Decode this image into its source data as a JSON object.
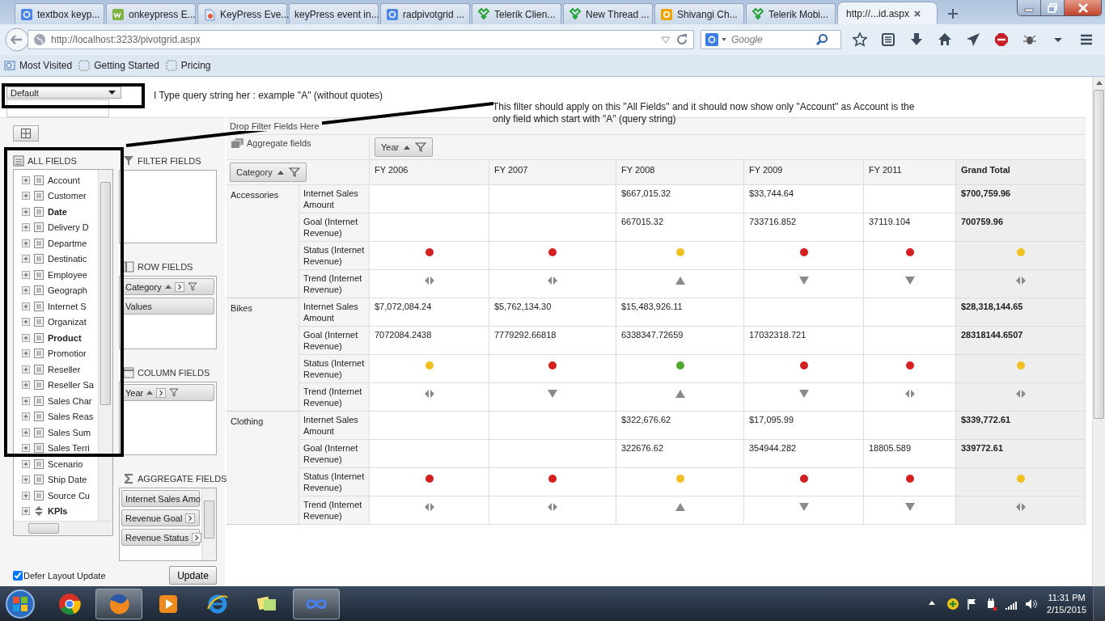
{
  "browser": {
    "tabs": [
      {
        "title": "textbox keyp...",
        "selected": false
      },
      {
        "title": "onkeypress E...",
        "selected": false
      },
      {
        "title": "KeyPress Eve...",
        "selected": false
      },
      {
        "title": "keyPress event in...",
        "selected": false
      },
      {
        "title": "radpivotgrid ...",
        "selected": false
      },
      {
        "title": "Telerik Clien...",
        "selected": false
      },
      {
        "title": "New Thread ...",
        "selected": false
      },
      {
        "title": "Shivangi Ch...",
        "selected": false
      },
      {
        "title": "Telerik Mobi...",
        "selected": false
      },
      {
        "title": "http://...id.aspx",
        "selected": true
      }
    ],
    "url": "http://localhost:3233/pivotgrid.aspx",
    "search_placeholder": "Google",
    "bookmarks": [
      "Most Visited",
      "Getting Started",
      "Pricing"
    ]
  },
  "page": {
    "view_select": "Default"
  },
  "annotations": [
    "I Type query string her : example \"A\" (without quotes)",
    "This filter should apply on this \"All Fields\" and it should now show only \"Account\" as Account is the only field which start with \"A\" (query string)"
  ],
  "field_list": {
    "all_fields": {
      "title": "ALL FIELDS",
      "items": [
        {
          "label": "Account",
          "bold": false,
          "kind": "dimension"
        },
        {
          "label": "Customer",
          "bold": false,
          "kind": "dimension"
        },
        {
          "label": "Date",
          "bold": true,
          "kind": "dimension"
        },
        {
          "label": "Delivery D",
          "bold": false,
          "kind": "dimension"
        },
        {
          "label": "Departme",
          "bold": false,
          "kind": "dimension"
        },
        {
          "label": "Destinatic",
          "bold": false,
          "kind": "dimension"
        },
        {
          "label": "Employee",
          "bold": false,
          "kind": "dimension"
        },
        {
          "label": "Geograph",
          "bold": false,
          "kind": "dimension"
        },
        {
          "label": "Internet S",
          "bold": false,
          "kind": "dimension"
        },
        {
          "label": "Organizat",
          "bold": false,
          "kind": "dimension"
        },
        {
          "label": "Product",
          "bold": true,
          "kind": "dimension"
        },
        {
          "label": "Promotior",
          "bold": false,
          "kind": "dimension"
        },
        {
          "label": "Reseller",
          "bold": false,
          "kind": "dimension"
        },
        {
          "label": "Reseller Sa",
          "bold": false,
          "kind": "dimension"
        },
        {
          "label": "Sales Char",
          "bold": false,
          "kind": "dimension"
        },
        {
          "label": "Sales Reas",
          "bold": false,
          "kind": "dimension"
        },
        {
          "label": "Sales Sum",
          "bold": false,
          "kind": "dimension"
        },
        {
          "label": "Sales Terri",
          "bold": false,
          "kind": "dimension"
        },
        {
          "label": "Scenario",
          "bold": false,
          "kind": "dimension"
        },
        {
          "label": "Ship Date",
          "bold": false,
          "kind": "dimension"
        },
        {
          "label": "Source Cu",
          "bold": false,
          "kind": "dimension"
        },
        {
          "label": "KPIs",
          "bold": true,
          "kind": "kpi"
        }
      ]
    },
    "sections": [
      {
        "kind": "filter",
        "title": "FILTER FIELDS"
      },
      {
        "kind": "row",
        "title": "ROW FIELDS",
        "chips": [
          {
            "label": "Category",
            "kind": "dimension"
          },
          {
            "label": "Values",
            "kind": "values"
          }
        ]
      },
      {
        "kind": "column",
        "title": "COLUMN FIELDS",
        "chips": [
          {
            "label": "Year",
            "kind": "dimension"
          }
        ]
      },
      {
        "kind": "aggregate",
        "title": "AGGREGATE FIELDS",
        "chips": [
          {
            "label": "Internet Sales Amo",
            "kind": "measure"
          },
          {
            "label": "Revenue Goal",
            "kind": "measure"
          },
          {
            "label": "Revenue Status",
            "kind": "measure"
          }
        ]
      }
    ],
    "defer_update": {
      "label": "Defer Layout Update",
      "checked": true
    },
    "update_button": "Update"
  },
  "pivot": {
    "filter_zone": "Drop Filter Fields Here",
    "aggregate_zone": "Aggregate fields",
    "column_chip": "Year",
    "row_chip": "Category",
    "columns": [
      {
        "label": "FY 2006",
        "kind": "year"
      },
      {
        "label": "FY 2007",
        "kind": "year"
      },
      {
        "label": "FY 2008",
        "kind": "year"
      },
      {
        "label": "FY 2009",
        "kind": "year"
      },
      {
        "label": "FY 2011",
        "kind": "year"
      },
      {
        "label": "Grand Total",
        "kind": "total"
      }
    ],
    "rows": [
      {
        "category": "Accessories",
        "measures": [
          {
            "label": "Internet Sales Amount",
            "cells": [
              {
                "kind": "blank"
              },
              {
                "kind": "blank"
              },
              {
                "kind": "text",
                "text": "$667,015.32"
              },
              {
                "kind": "text",
                "text": "$33,744.64"
              },
              {
                "kind": "blank"
              },
              {
                "kind": "text",
                "text": "$700,759.96"
              }
            ]
          },
          {
            "label": "Goal (Internet Revenue)",
            "cells": [
              {
                "kind": "blank"
              },
              {
                "kind": "blank"
              },
              {
                "kind": "text",
                "text": "667015.32"
              },
              {
                "kind": "text",
                "text": "733716.852"
              },
              {
                "kind": "text",
                "text": "37119.104"
              },
              {
                "kind": "text",
                "text": "700759.96"
              }
            ]
          },
          {
            "label": "Status (Internet Revenue)",
            "cells": [
              {
                "kind": "status",
                "color": "#d42020"
              },
              {
                "kind": "status",
                "color": "#d42020"
              },
              {
                "kind": "status",
                "color": "#f0c020"
              },
              {
                "kind": "status",
                "color": "#d42020"
              },
              {
                "kind": "status",
                "color": "#d42020"
              },
              {
                "kind": "status",
                "color": "#f0c020"
              }
            ]
          },
          {
            "label": "Trend (Internet Revenue)",
            "cells": [
              {
                "kind": "flat"
              },
              {
                "kind": "flat"
              },
              {
                "kind": "up"
              },
              {
                "kind": "down"
              },
              {
                "kind": "down"
              },
              {
                "kind": "flat"
              }
            ]
          }
        ]
      },
      {
        "category": "Bikes",
        "measures": [
          {
            "label": "Internet Sales Amount",
            "cells": [
              {
                "kind": "text",
                "text": "$7,072,084.24"
              },
              {
                "kind": "text",
                "text": "$5,762,134.30"
              },
              {
                "kind": "text",
                "text": "$15,483,926.11"
              },
              {
                "kind": "blank"
              },
              {
                "kind": "blank"
              },
              {
                "kind": "text",
                "text": "$28,318,144.65"
              }
            ]
          },
          {
            "label": "Goal (Internet Revenue)",
            "cells": [
              {
                "kind": "text",
                "text": "7072084.2438"
              },
              {
                "kind": "text",
                "text": "7779292.66818"
              },
              {
                "kind": "text",
                "text": "6338347.72659"
              },
              {
                "kind": "text",
                "text": "17032318.721"
              },
              {
                "kind": "blank"
              },
              {
                "kind": "text",
                "text": "28318144.6507"
              }
            ]
          },
          {
            "label": "Status (Internet Revenue)",
            "cells": [
              {
                "kind": "status",
                "color": "#f0c020"
              },
              {
                "kind": "status",
                "color": "#d42020"
              },
              {
                "kind": "status",
                "color": "#50a830"
              },
              {
                "kind": "status",
                "color": "#d42020"
              },
              {
                "kind": "status",
                "color": "#d42020"
              },
              {
                "kind": "status",
                "color": "#f0c020"
              }
            ]
          },
          {
            "label": "Trend (Internet Revenue)",
            "cells": [
              {
                "kind": "flat"
              },
              {
                "kind": "down"
              },
              {
                "kind": "up"
              },
              {
                "kind": "down"
              },
              {
                "kind": "flat"
              },
              {
                "kind": "flat"
              }
            ]
          }
        ]
      },
      {
        "category": "Clothing",
        "measures": [
          {
            "label": "Internet Sales Amount",
            "cells": [
              {
                "kind": "blank"
              },
              {
                "kind": "blank"
              },
              {
                "kind": "text",
                "text": "$322,676.62"
              },
              {
                "kind": "text",
                "text": "$17,095.99"
              },
              {
                "kind": "blank"
              },
              {
                "kind": "text",
                "text": "$339,772.61"
              }
            ]
          },
          {
            "label": "Goal (Internet Revenue)",
            "cells": [
              {
                "kind": "blank"
              },
              {
                "kind": "blank"
              },
              {
                "kind": "text",
                "text": "322676.62"
              },
              {
                "kind": "text",
                "text": "354944.282"
              },
              {
                "kind": "text",
                "text": "18805.589"
              },
              {
                "kind": "text",
                "text": "339772.61"
              }
            ]
          },
          {
            "label": "Status (Internet Revenue)",
            "cells": [
              {
                "kind": "status",
                "color": "#d42020"
              },
              {
                "kind": "status",
                "color": "#d42020"
              },
              {
                "kind": "status",
                "color": "#f0c020"
              },
              {
                "kind": "status",
                "color": "#d42020"
              },
              {
                "kind": "status",
                "color": "#d42020"
              },
              {
                "kind": "status",
                "color": "#f0c020"
              }
            ]
          },
          {
            "label": "Trend (Internet Revenue)",
            "cells": [
              {
                "kind": "flat"
              },
              {
                "kind": "flat"
              },
              {
                "kind": "up"
              },
              {
                "kind": "down"
              },
              {
                "kind": "down"
              },
              {
                "kind": "flat"
              }
            ]
          }
        ]
      }
    ]
  },
  "taskbar": {
    "apps": [
      {
        "active": false
      },
      {
        "active": true
      },
      {
        "active": false
      },
      {
        "active": false
      },
      {
        "active": false
      },
      {
        "active": true
      }
    ],
    "time": "11:31 PM",
    "date": "2/15/2015"
  }
}
